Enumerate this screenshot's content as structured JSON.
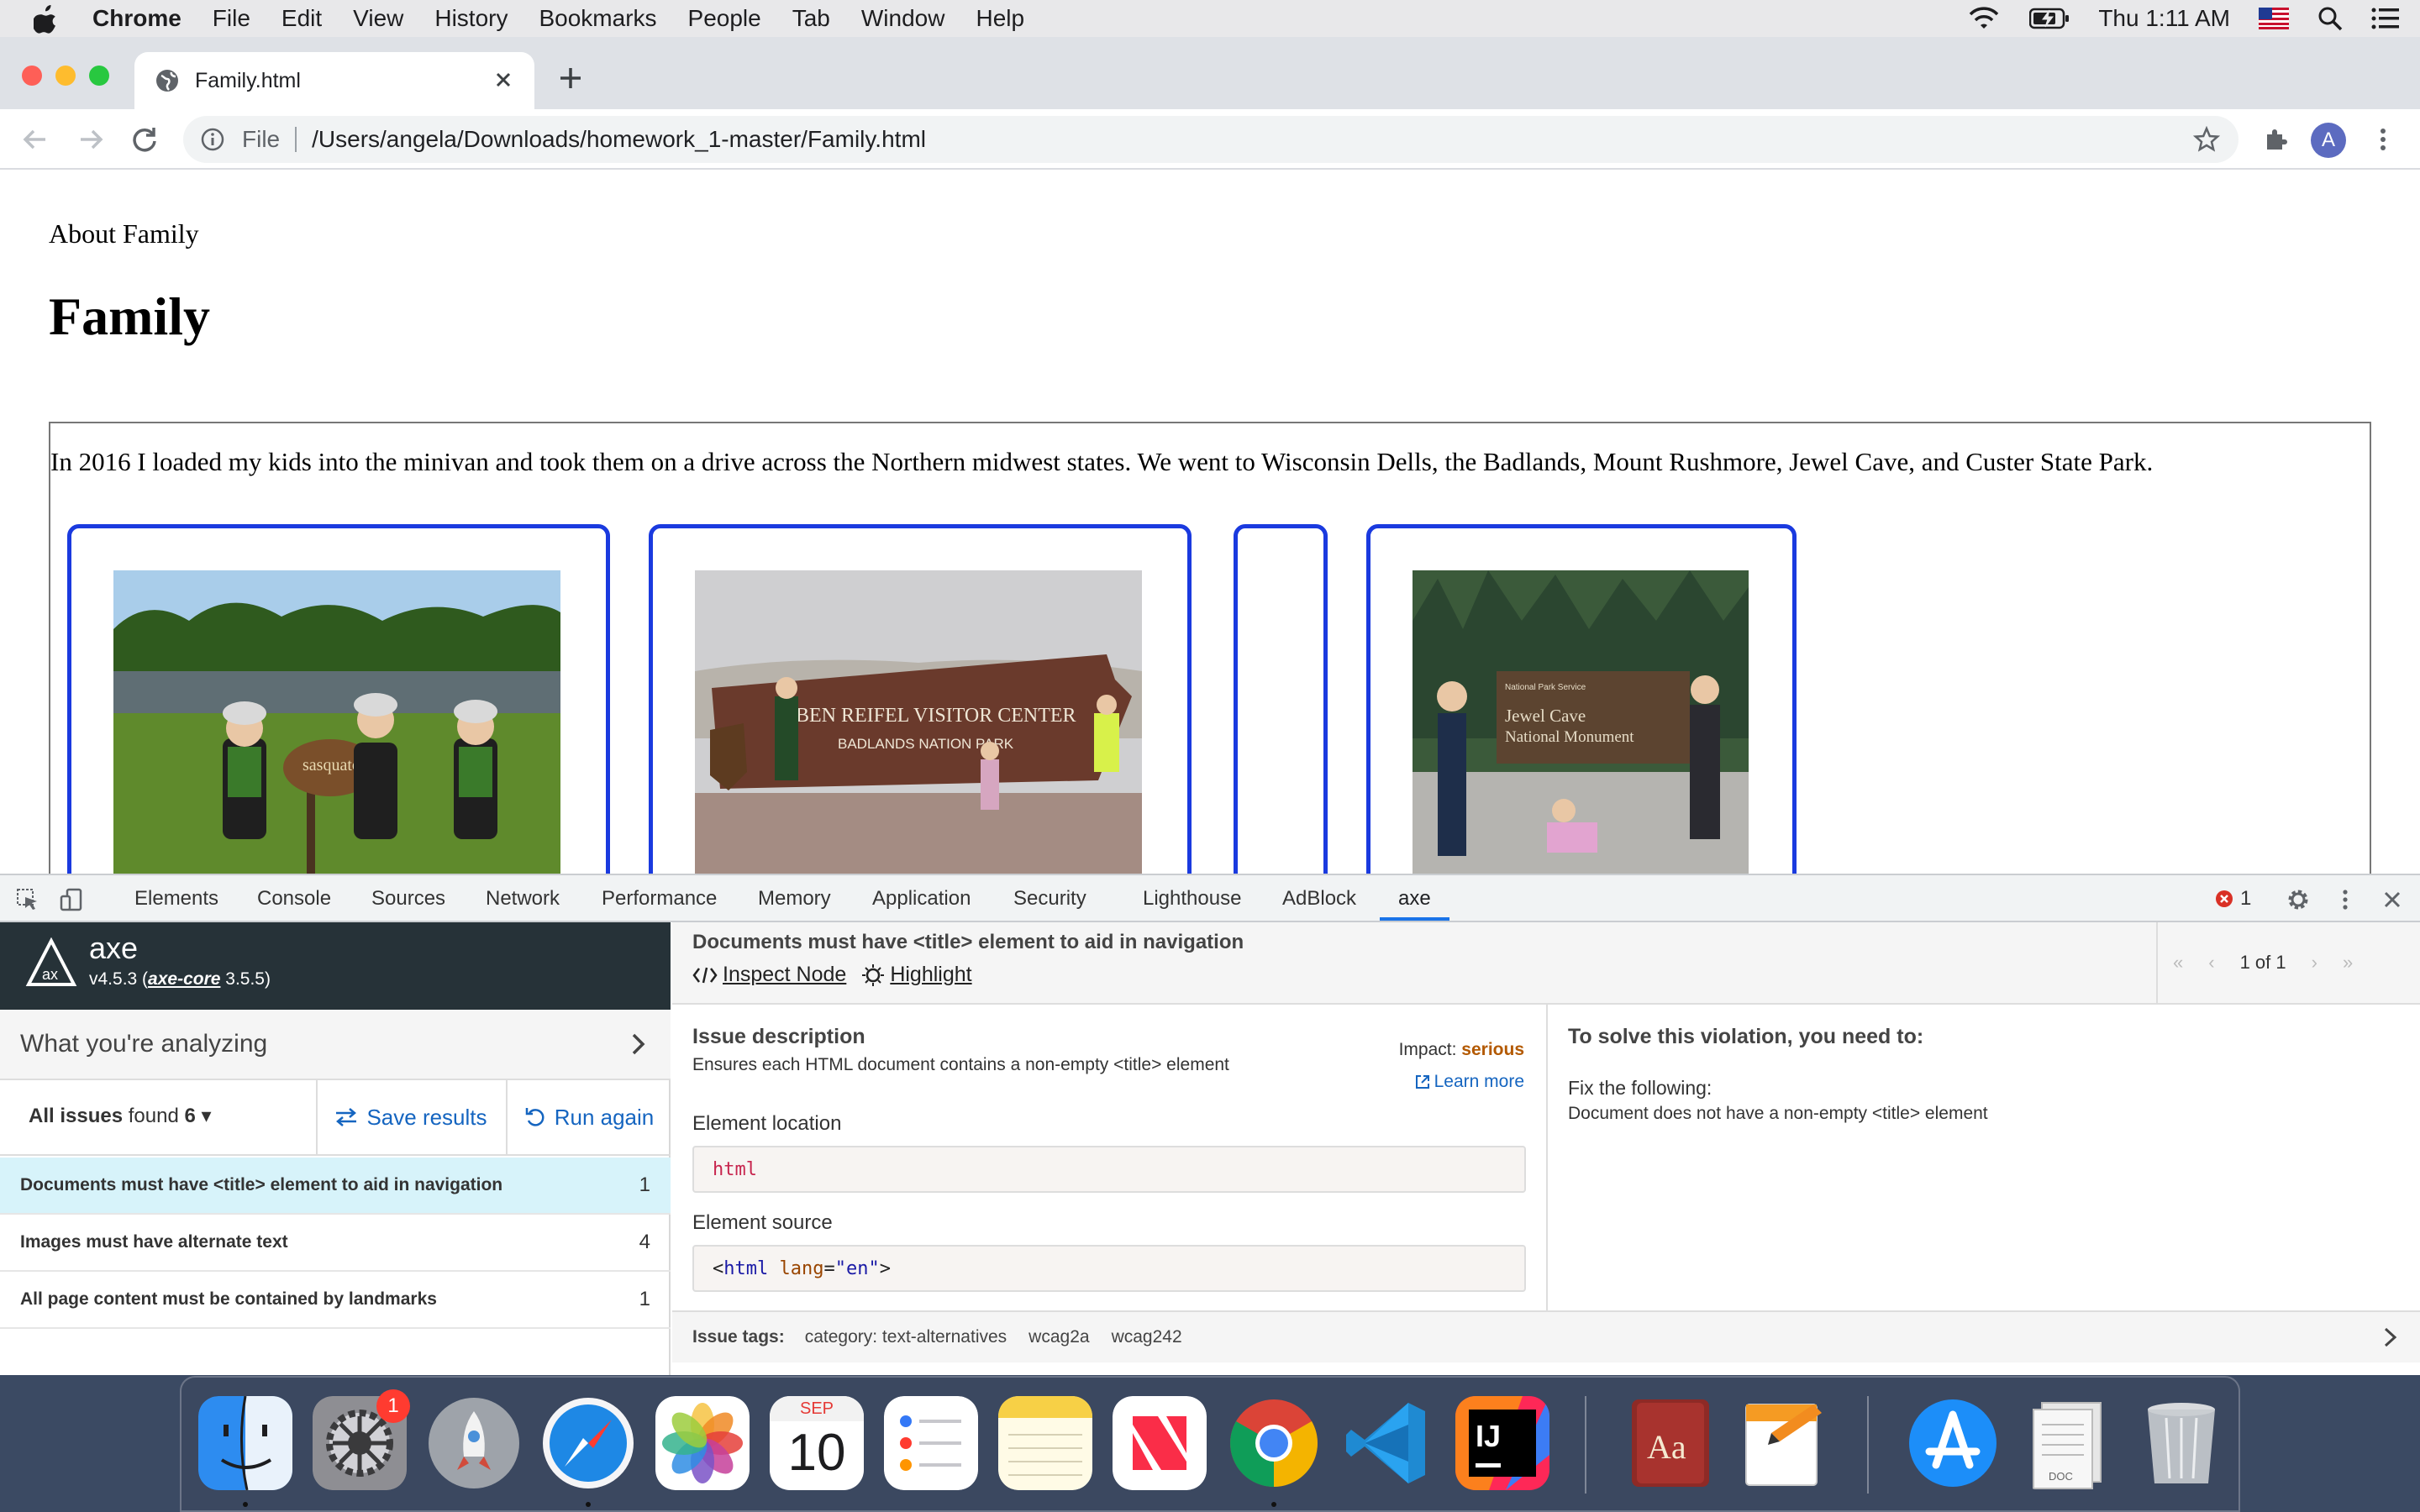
{
  "menubar": {
    "app": "Chrome",
    "items": [
      "File",
      "Edit",
      "View",
      "History",
      "Bookmarks",
      "People",
      "Tab",
      "Window",
      "Help"
    ],
    "clock": "Thu 1:11 AM"
  },
  "browser": {
    "tab_title": "Family.html",
    "url_scheme": "File",
    "url": "/Users/angela/Downloads/homework_1-master/Family.html",
    "avatar_letter": "A"
  },
  "page": {
    "nav_link": "About Family",
    "heading": "Family",
    "paragraph": "In 2016 I loaded my kids into the minivan and took them on a drive across the Northern midwest states. We went to Wisconsin Dells, the Badlands, Mount Rushmore, Jewel Cave, and Custer State Park.",
    "photo2_sign_line1": "BEN REIFEL VISITOR CENTER",
    "photo2_sign_line2": "BADLANDS NATION    PARK",
    "photo3_sign_line1": "Jewel Cave",
    "photo3_sign_line2": "National Monument"
  },
  "devtools": {
    "tabs": [
      "Elements",
      "Console",
      "Sources",
      "Network",
      "Performance",
      "Memory",
      "Application",
      "Security",
      "Lighthouse",
      "AdBlock",
      "axe"
    ],
    "active_tab": "axe",
    "error_count": "1"
  },
  "axe": {
    "name": "axe",
    "version_prefix": "v4.5.3 (",
    "core_link": "axe-core",
    "core_version": " 3.5.5)",
    "analyzing_label": "What you're analyzing",
    "filter_strong": "All issues",
    "filter_found": " found ",
    "filter_count": "6",
    "save_label": "Save results",
    "run_label": "Run again",
    "issues": [
      {
        "label": "Documents must have <title> element to aid in navigation",
        "count": "1"
      },
      {
        "label": "Images must have alternate text",
        "count": "4"
      },
      {
        "label": "All page content must be contained by landmarks",
        "count": "1"
      }
    ],
    "detail": {
      "title": "Documents must have <title> element to aid in navigation",
      "inspect_label": "Inspect Node",
      "highlight_label": "Highlight",
      "pager": "1 of 1",
      "desc_heading": "Issue description",
      "desc_text": "Ensures each HTML document contains a non-empty <title> element",
      "impact_label": "Impact: ",
      "impact_value": "serious",
      "learn_more": "Learn more",
      "location_label": "Element location",
      "location_value": "html",
      "source_label": "Element source",
      "source_tag": "html",
      "source_attr": "lang",
      "source_value": "\"en\"",
      "solve_heading": "To solve this violation, you need to:",
      "fix_heading": "Fix the following:",
      "fix_text": "Document does not have a non-empty <title> element",
      "tags_label": "Issue tags:",
      "tags": [
        "category: text-alternatives",
        "wcag2a",
        "wcag242"
      ]
    }
  },
  "dock": {
    "calendar_month": "SEP",
    "calendar_day": "10",
    "prefs_badge": "1"
  },
  "colors": {
    "card_border": "#1a3adf",
    "axe_dark": "#263238",
    "link_blue": "#1565c0",
    "selected_row": "#d7f3fa",
    "impact": "#b35900"
  }
}
